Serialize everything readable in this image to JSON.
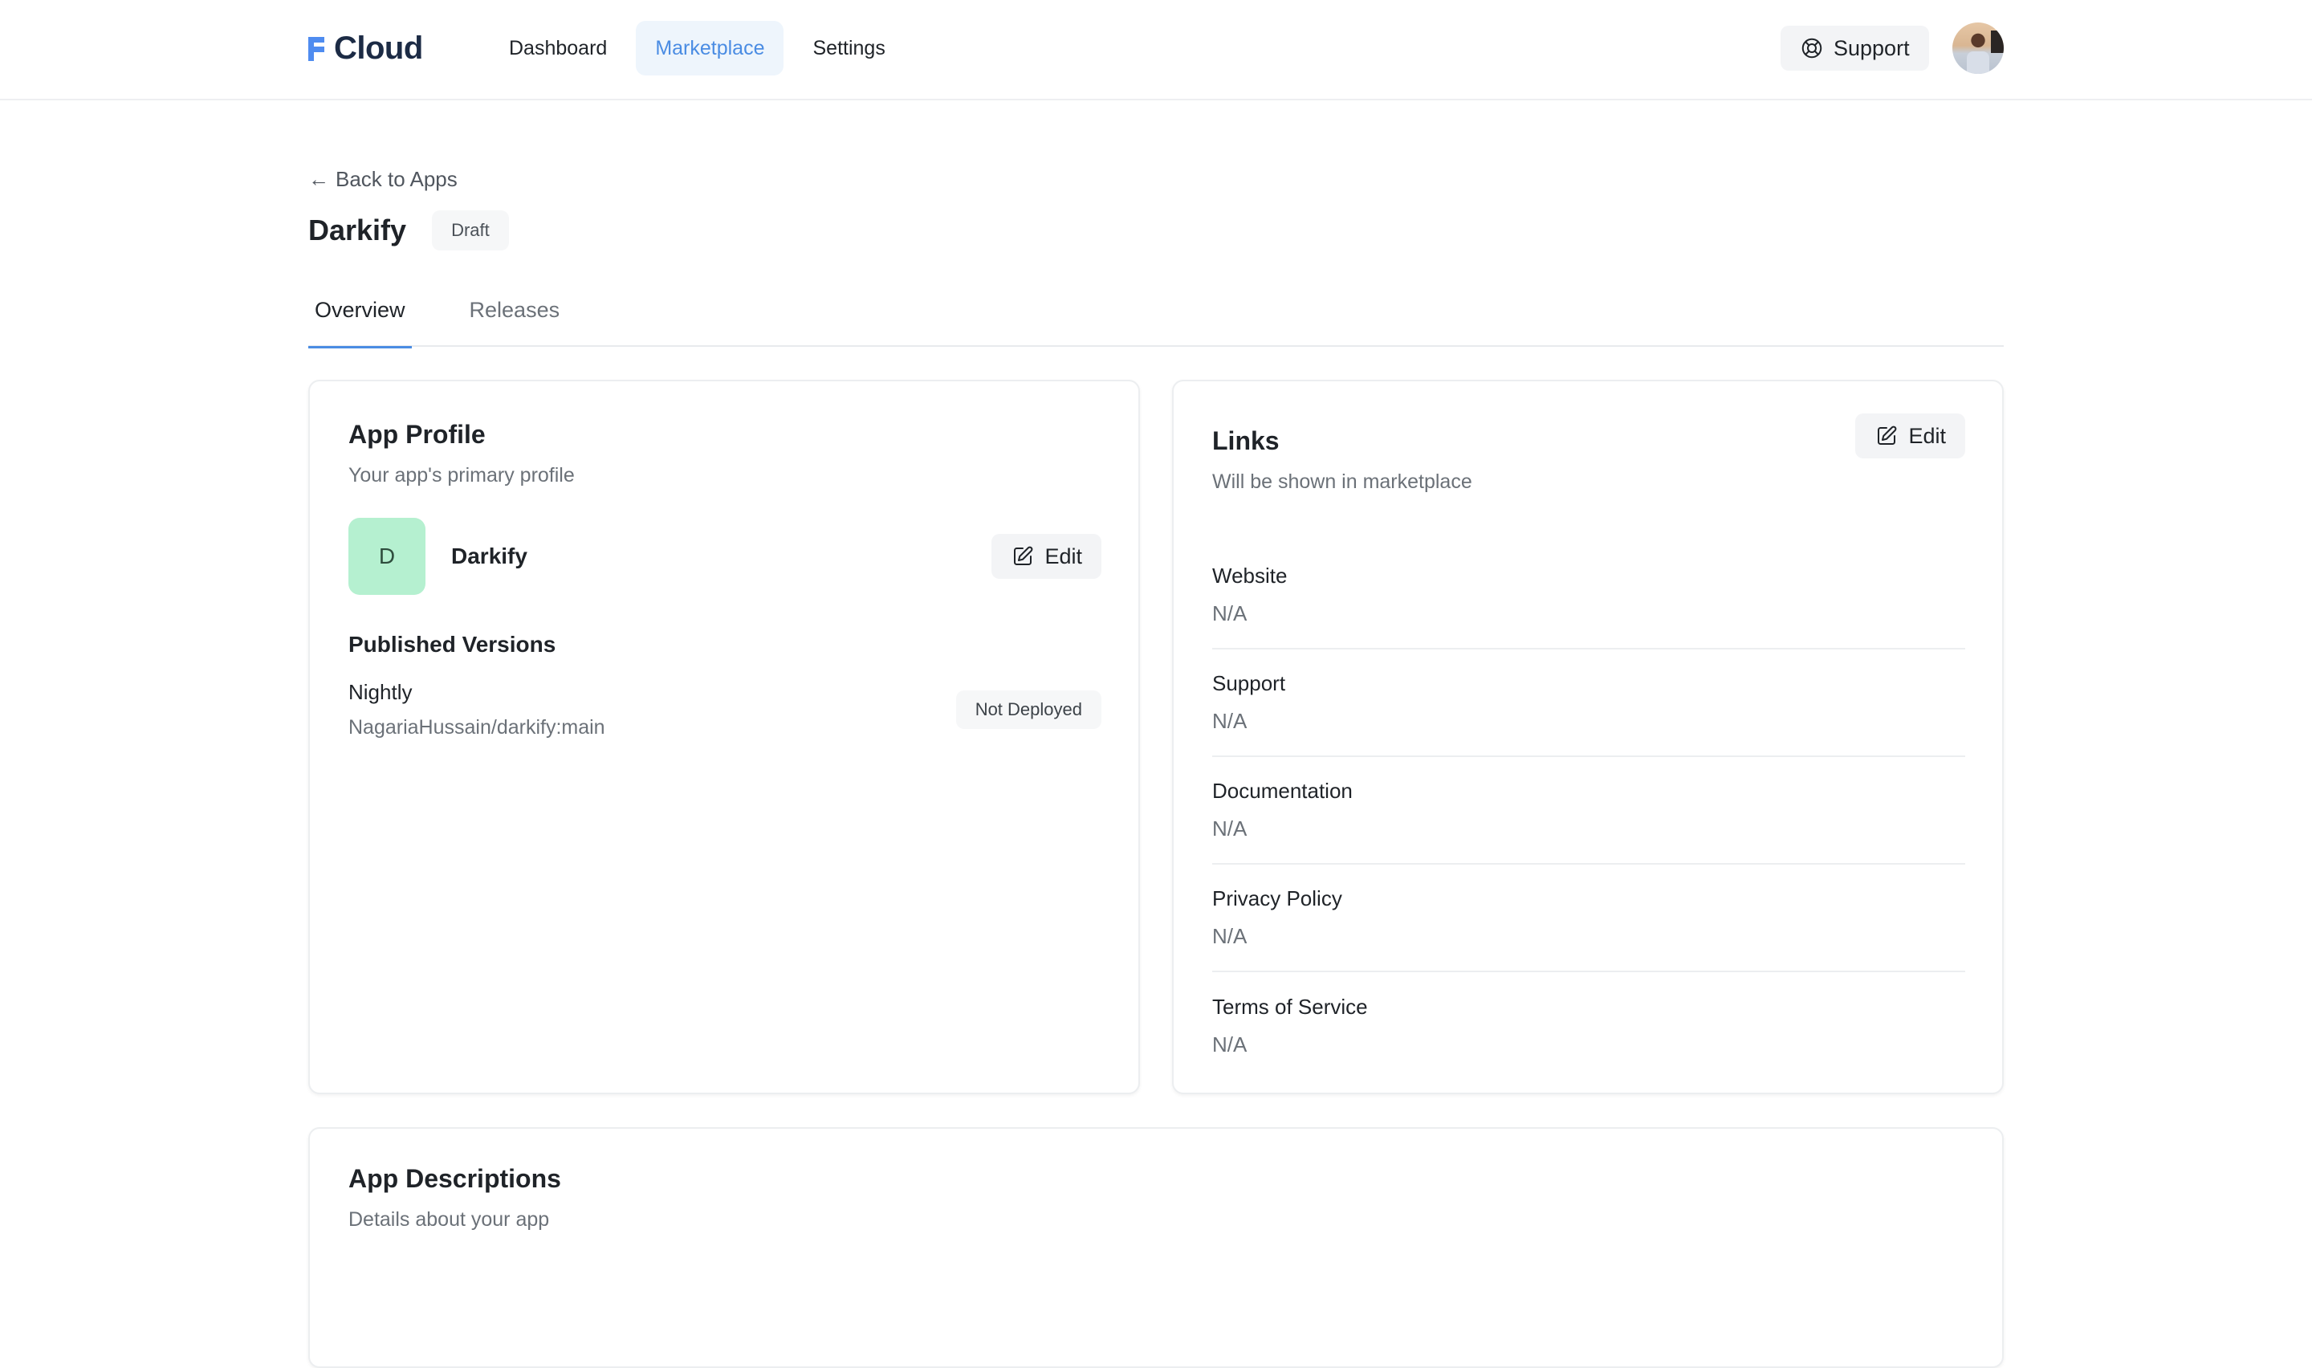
{
  "header": {
    "logo_text": "Cloud",
    "nav": [
      {
        "label": "Dashboard",
        "active": false
      },
      {
        "label": "Marketplace",
        "active": true
      },
      {
        "label": "Settings",
        "active": false
      }
    ],
    "support_label": "Support",
    "support_icon": "lifebuoy-icon",
    "avatar_icon": "user-avatar"
  },
  "page": {
    "back_link": "Back to Apps",
    "back_icon": "arrow-left-icon",
    "title": "Darkify",
    "status": "Draft",
    "tabs": [
      {
        "label": "Overview",
        "active": true
      },
      {
        "label": "Releases",
        "active": false
      }
    ]
  },
  "profile_card": {
    "title": "App Profile",
    "subtitle": "Your app's primary profile",
    "app_initial": "D",
    "app_name": "Darkify",
    "edit_label": "Edit",
    "app_icon_color": "#b5f0d0",
    "published_title": "Published Versions",
    "versions": [
      {
        "name": "Nightly",
        "source": "NagariaHussain/darkify:main",
        "status": "Not Deployed"
      }
    ]
  },
  "links_card": {
    "title": "Links",
    "subtitle": "Will be shown in marketplace",
    "edit_label": "Edit",
    "items": [
      {
        "label": "Website",
        "value": "N/A"
      },
      {
        "label": "Support",
        "value": "N/A"
      },
      {
        "label": "Documentation",
        "value": "N/A"
      },
      {
        "label": "Privacy Policy",
        "value": "N/A"
      },
      {
        "label": "Terms of Service",
        "value": "N/A"
      }
    ]
  },
  "descriptions_card": {
    "title": "App Descriptions",
    "subtitle": "Details about your app"
  },
  "colors": {
    "accent": "#4a8ce3",
    "nav_active_bg": "#eef5fc",
    "logo_mark": "#4f8cf0",
    "logo_text": "#1c2b45"
  }
}
